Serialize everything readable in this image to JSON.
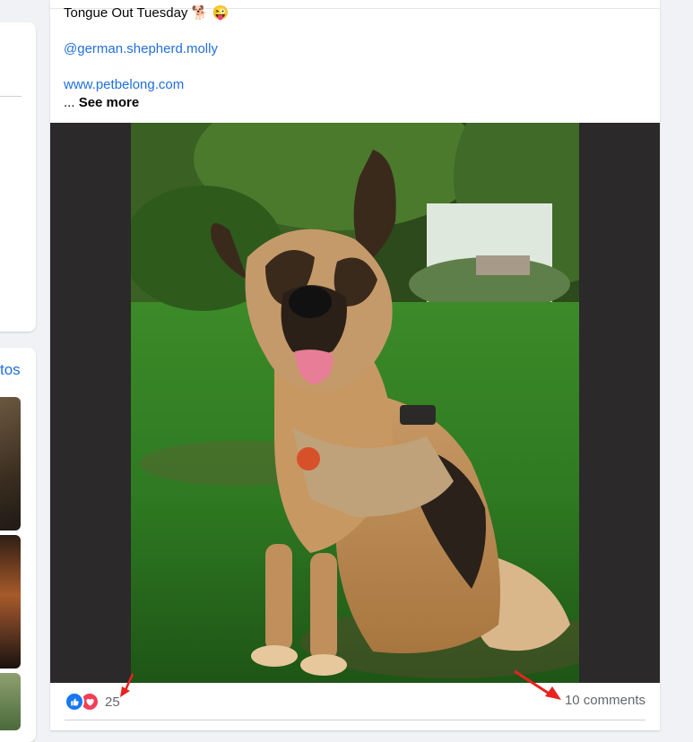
{
  "post": {
    "title_line": "Tongue Out Tuesday 🐕 😜",
    "mention": "@german.shepherd.molly",
    "link": "www.petbelong.com",
    "see_more_prefix": "...",
    "see_more_label": "See more",
    "photo_alt": "German shepherd wearing a tan harness sitting on grass",
    "reaction_count": "25",
    "comments_label": "10 comments"
  },
  "sidebar": {
    "photos_link_fragment": "tos"
  },
  "colors": {
    "link": "#216fdb",
    "like": "#1877f2",
    "love": "#f33e58",
    "annotation_arrow": "#e8231f"
  },
  "icons": [
    "like-icon",
    "love-icon",
    "annotation-arrow"
  ]
}
